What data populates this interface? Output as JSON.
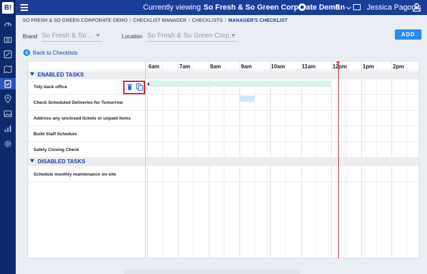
{
  "topbar": {
    "viewing_label": "Currently viewing",
    "organization": "So Fresh & So Green Corporate Demo",
    "language": "En",
    "user_name": "Jessica Pagonis"
  },
  "breadcrumb": {
    "items": [
      "SO FRESH & SO GREEN CORPORATE DEMO",
      "CHECKLIST MANAGER",
      "CHECKLISTS",
      "MANAGER'S CHECKLIST"
    ]
  },
  "filters": {
    "brand_label": "Brand",
    "brand_value": "So Fresh & So ...",
    "location_label": "Location",
    "location_value": "So Fresh & So Green Corp..."
  },
  "actions": {
    "add_label": "ADD",
    "back_label": "Back to Checklists"
  },
  "timeline": {
    "hours": [
      "6am",
      "7am",
      "8am",
      "9am",
      "10am",
      "11am",
      "12pm",
      "1pm",
      "2pm"
    ]
  },
  "sections": {
    "enabled": "ENABLED TASKS",
    "disabled": "DISABLED TASKS"
  },
  "tasks": {
    "enabled": [
      "Tidy back office",
      "Check Scheduled Deliveries for Tomorrow",
      "Address any unclosed tickets or unpaid items",
      "Build Staff Schedule",
      "Safety Closing Check"
    ],
    "disabled": [
      "Schedule monthly maintenance on-site"
    ]
  },
  "colors": {
    "nav": "#0f2a6b",
    "topbar": "#1a3d9a",
    "accent": "#2a8af0",
    "current_time": "#e0353d",
    "highlight_box": "#e3212b",
    "task_bar_green": "#d6f3e5",
    "task_bar_blue": "#d4e6fb"
  },
  "icons": [
    "logo",
    "hamburger-icon",
    "dashboard-icon",
    "edit-icon",
    "map-icon",
    "checklist-icon",
    "location-icon",
    "image-icon",
    "analytics-icon",
    "settings-icon",
    "chat-icon",
    "user-icon",
    "trash-icon",
    "copy-icon",
    "back-arrow-icon"
  ]
}
